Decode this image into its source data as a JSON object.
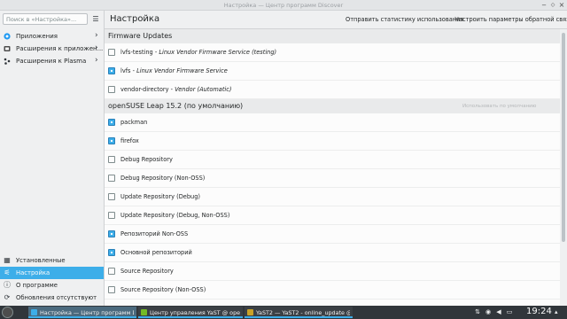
{
  "window": {
    "title": "Настройка — Центр программ Discover"
  },
  "sidebar": {
    "search_placeholder": "Поиск в «Настройка»...",
    "nav": [
      {
        "label": "Приложения",
        "icon": "applications-icon"
      },
      {
        "label": "Расширения к приложен...",
        "icon": "addons-icon"
      },
      {
        "label": "Расширения к Plasma",
        "icon": "plasma-addons-icon"
      }
    ],
    "bottom": [
      {
        "label": "Установленные",
        "icon": "installed-icon"
      },
      {
        "label": "Настройка",
        "icon": "settings-icon",
        "active": true
      },
      {
        "label": "О программе",
        "icon": "about-icon"
      },
      {
        "label": "Обновления отсутствуют",
        "icon": "updates-icon"
      }
    ]
  },
  "header": {
    "title": "Настройка",
    "action1": "Отправить статистику использования",
    "action2": "Настроить параметры обратной связи"
  },
  "sections": [
    {
      "title": "Firmware Updates",
      "action": "",
      "repos": [
        {
          "name": "lvfs-testing",
          "desc": "Linux Vendor Firmware Service (testing)",
          "checked": false
        },
        {
          "name": "lvfs",
          "desc": "Linux Vendor Firmware Service",
          "checked": true
        },
        {
          "name": "vendor-directory",
          "desc": "Vendor (Automatic)",
          "checked": false
        }
      ]
    },
    {
      "title": "openSUSE Leap 15.2 (по умолчанию)",
      "action": "Использовать по умолчанию",
      "repos": [
        {
          "name": "packman",
          "checked": true
        },
        {
          "name": "firefox",
          "checked": true
        },
        {
          "name": "Debug Repository",
          "checked": false
        },
        {
          "name": "Debug Repository (Non-OSS)",
          "checked": false
        },
        {
          "name": "Update Repository (Debug)",
          "checked": false
        },
        {
          "name": "Update Repository (Debug, Non-OSS)",
          "checked": false
        },
        {
          "name": "Репозиторий Non-OSS",
          "checked": true
        },
        {
          "name": "Основной репозиторий",
          "checked": true
        },
        {
          "name": "Source Repository",
          "checked": false
        },
        {
          "name": "Source Repository (Non-OSS)",
          "checked": false
        }
      ]
    }
  ],
  "taskbar": {
    "tasks": [
      {
        "label": "Настройка — Центр программ Di...",
        "icon_color": "#3daee9",
        "active": true
      },
      {
        "label": "Центр управления YaST @ openS...",
        "icon_color": "#73ba25",
        "active": false
      },
      {
        "label": "YaST2 — YaST2 - online_update @ ...",
        "icon_color": "#c9a227",
        "active": false
      }
    ],
    "clock": "19:24",
    "tray_icons": [
      "network-icon",
      "discover-icon",
      "volume-icon",
      "battery-icon"
    ]
  },
  "colors": {
    "accent": "#3daee9",
    "background": "#eff0f1",
    "view": "#fcfcfc",
    "taskbar": "#31363b"
  }
}
